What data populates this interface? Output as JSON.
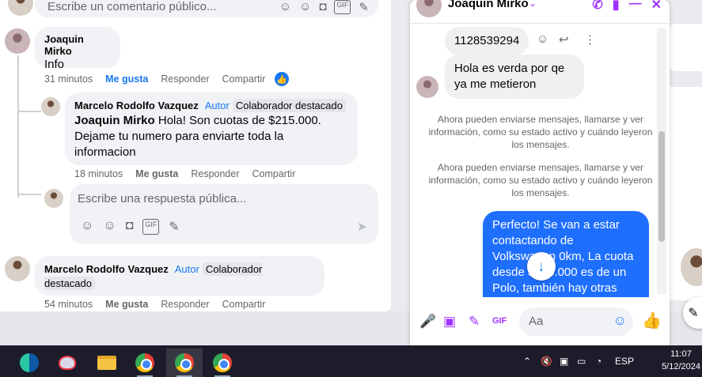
{
  "feed": {
    "top_placeholder": "Escribe un comentario público...",
    "comments": [
      {
        "author": "Joaquin Mirko",
        "text": "Info",
        "time": "31 minutos",
        "like": "Me gusta",
        "reply": "Responder",
        "share": "Compartir"
      },
      {
        "author": "Marcelo Rodolfo Vazquez",
        "badge_autor": "Autor",
        "badge_collab": "Colaborador destacado",
        "mention": "Joaquin Mirko",
        "text_line1": " Hola! Son cuotas de $215.000.",
        "text_line2": "Dejame tu numero para enviarte toda la",
        "text_line3": "informacion",
        "time": "18 minutos",
        "like": "Me gusta",
        "reply": "Responder",
        "share": "Compartir"
      },
      {
        "author": "Marcelo Rodolfo Vazquez",
        "badge_autor": "Autor",
        "badge_collab": "Colaborador destacado",
        "text": ".",
        "time": "54 minutos",
        "like": "Me gusta",
        "reply": "Responder",
        "share": "Compartir"
      }
    ],
    "reply_placeholder": "Escribe una respuesta pública..."
  },
  "chat": {
    "contact_name": "Joaquin Mirko",
    "messages": [
      {
        "from": "them",
        "text": "1128539294"
      },
      {
        "from": "them",
        "text_line1": "Hola es verda por qe",
        "text_line2": "ya me metieron"
      }
    ],
    "system_notices": [
      "Ahora pueden enviarse mensajes, llamarse y ver información, como su estado activo y cuándo leyeron los mensajes.",
      "Ahora pueden enviarse mensajes, llamarse y ver información, como su estado activo y cuándo leyeron los mensajes."
    ],
    "mine": "Perfecto!  Se van a estar contactando de Volkswagen 0km, La cuota desde $215.000 es de un Polo, también hay otras",
    "composer_placeholder": "Aa"
  },
  "taskbar": {
    "language": "ESP",
    "time": "11:07",
    "date": "5/12/2024"
  },
  "colors": {
    "accent": "#1877f2",
    "messenger": "#a033ff",
    "my_bubble": "#1f6fff"
  }
}
